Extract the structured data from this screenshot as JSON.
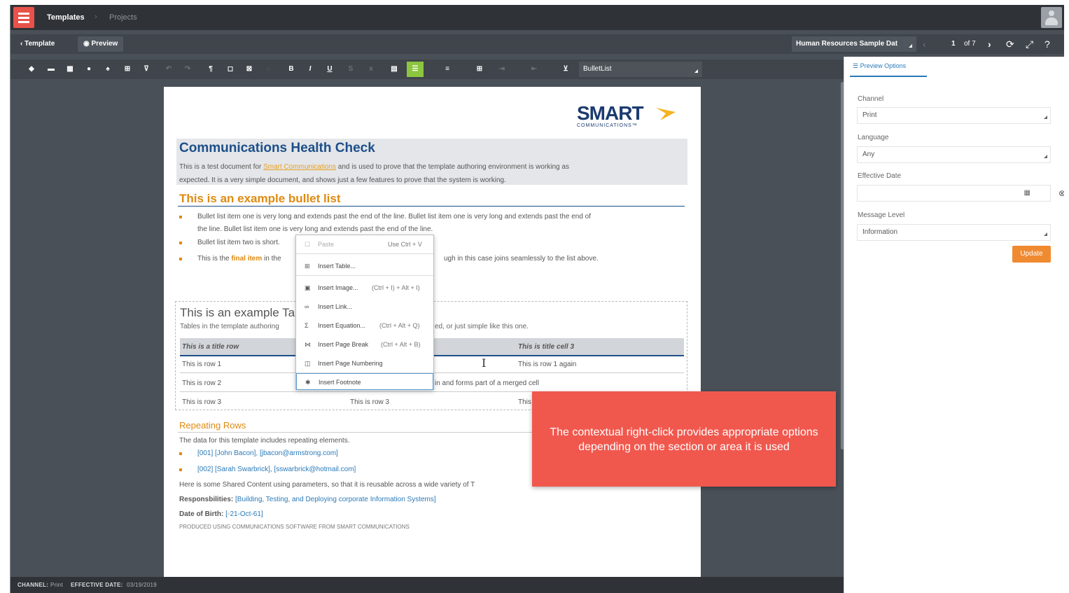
{
  "topbar": {
    "breadcrumb": [
      "Templates",
      "Projects"
    ]
  },
  "navbar": {
    "back_label": "Template",
    "preview_label": "Preview",
    "document_select": "Human Resources Sample Dat",
    "page_current": "1",
    "page_total": "of 7"
  },
  "toolbar": {
    "style_select": "BulletList"
  },
  "document": {
    "logo_main": "SMART",
    "logo_sub": "COMMUNICATIONS™",
    "health_title": "Communications Health Check",
    "health_line1_pre": "This is a test document for ",
    "health_line1_link": "Smart Communications",
    "health_line1_post": " and is used to prove that the template authoring environment is working as",
    "health_line2": "expected. It is a very simple document, and shows just a few features to prove that the system is working.",
    "bullet_heading": "This is an example bullet list",
    "bullet1_line1": "Bullet list item one is very long and extends past the end of the line. Bullet list item one is very long and extends past the end of",
    "bullet1_line2": "the line. Bullet list item one is very long and extends past the end of the line.",
    "bullet2": "Bullet list item two is short.",
    "bullet3_pre": "This is the ",
    "bullet3_bold": "final item",
    "bullet3_post": " in the",
    "bullet3_right": "ugh in this case joins seamlessly to the list above.",
    "table_heading": "This is an example Ta",
    "table_intro": "Tables in the template authoring",
    "table_intro_right": "ed, or just simple like this one.",
    "table_header": [
      "This is a title row",
      "This is title cell 3"
    ],
    "row1": [
      "This is row 1",
      "This is row 1 again"
    ],
    "row2": [
      "This is row 2",
      "in and forms part of a merged cell"
    ],
    "row3": [
      "This is row 3",
      "This is row 3",
      "This"
    ],
    "repeating_title": "Repeating Rows",
    "repeating_text": "The data for this template includes repeating elements.",
    "rep_item1": "[001] [John Bacon], [jbacon@armstrong.com]",
    "rep_item2": "[002] [Sarah Swarbrick], [sswarbrick@hotmail.com]",
    "shared_text": "Here is some Shared Content using parameters, so that it is reusable across a wide variety of T",
    "resp_label": "Responsbilities: ",
    "resp_value": "[Building, Testing, and Deploying corporate Information Systems]",
    "dob_label": "Date of Birth: ",
    "dob_value": "[",
    "dob_date": "21-Oct-61]",
    "footer_text": "PRODUCED USING COMMUNICATIONS SOFTWARE FROM SMART COMMUNICATIONS"
  },
  "context_menu": {
    "items": [
      {
        "label": "Paste",
        "shortcut": "Use Ctrl + V",
        "icon": "paste-icon"
      },
      {
        "label": "Insert Table...",
        "shortcut": "",
        "icon": "table-icon"
      },
      {
        "label": "Insert Image...",
        "shortcut": "(Ctrl + I) + Alt + I)",
        "icon": "image-icon"
      },
      {
        "label": "Insert Link...",
        "shortcut": "",
        "icon": "link-icon"
      },
      {
        "label": "Insert Equation...",
        "shortcut": "(Ctrl + Alt + Q)",
        "icon": "sigma-icon"
      },
      {
        "label": "Insert Page Break",
        "shortcut": "(Ctrl + Alt + B)",
        "icon": "page-break-icon"
      },
      {
        "label": "Insert Page Numbering",
        "shortcut": "",
        "icon": "page-number-icon"
      },
      {
        "label": "Insert Footnote",
        "shortcut": "",
        "icon": "footnote-icon"
      }
    ]
  },
  "callout": {
    "text": "The contextual right-click provides appropriate options depending on the section or area it is used"
  },
  "statusbar": {
    "channel_label": "CHANNEL:",
    "channel_value": "Print",
    "date_label": "EFFECTIVE DATE:",
    "date_value": "03/19/2019"
  },
  "panel": {
    "tab": "Preview Options",
    "channel_label": "Channel",
    "channel_value": "Print",
    "language_label": "Language",
    "language_value": "Any",
    "effective_label": "Effective Date",
    "effective_value": "",
    "message_label": "Message Level",
    "message_value": "Information",
    "update_label": "Update"
  },
  "colors": {
    "accent_red": "#e8524a",
    "accent_green": "#8cc63f",
    "heading_blue": "#1d4f8a",
    "heading_orange": "#e08a10",
    "callout": "#f0584e",
    "update_button": "#f08a30"
  }
}
